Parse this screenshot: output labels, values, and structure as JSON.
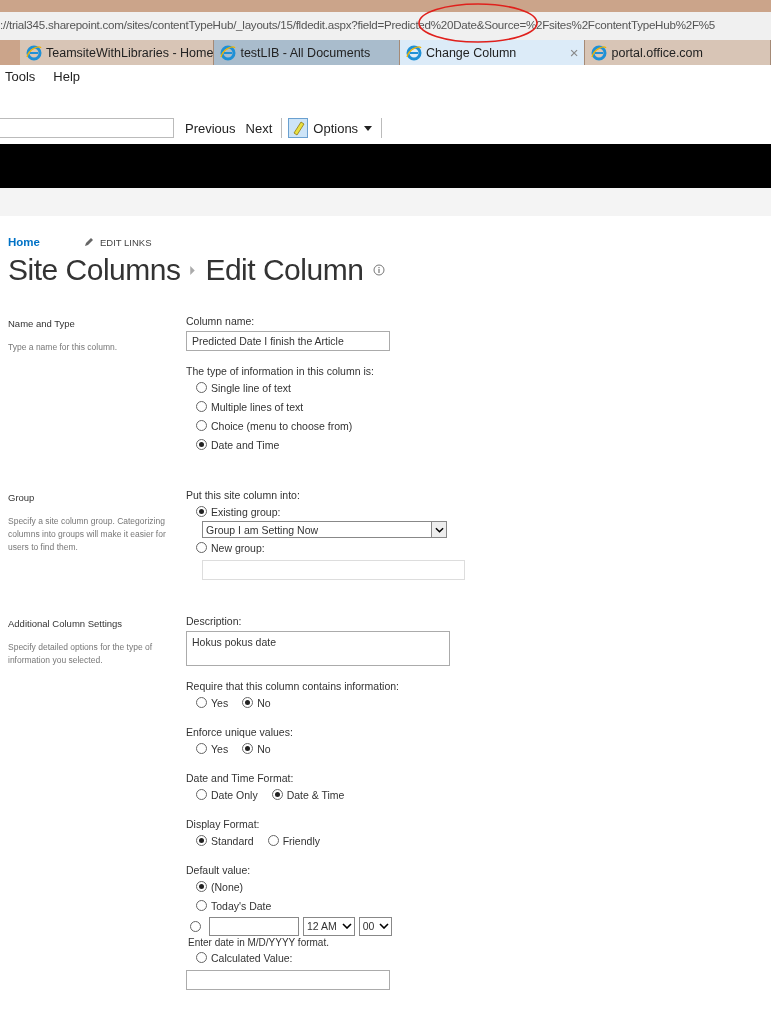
{
  "browser": {
    "address": "://trial345.sharepoint.com/sites/contentTypeHub/_layouts/15/fldedit.aspx?field=Predicted%20Date&Source=%2Fsites%2FcontentTypeHub%2F%5",
    "tabs": [
      {
        "label": "TeamsiteWithLibraries - Home",
        "selected": false
      },
      {
        "label": "testLIB - All Documents",
        "selected": false
      },
      {
        "label": "Change Column",
        "selected": true
      },
      {
        "label": "portal.office.com",
        "selected": false
      }
    ],
    "close_glyph": "×",
    "menu": [
      "Tools",
      "Help"
    ],
    "toolbar": {
      "buttons": [
        "Previous",
        "Next"
      ],
      "options": "Options"
    }
  },
  "page": {
    "home_link": "Home",
    "edit_links": "EDIT LINKS",
    "title": [
      "Site Columns",
      "Edit Column"
    ],
    "sections": [
      {
        "title": "Name and Type",
        "description": "Type a name for this column.",
        "items": [
          {
            "kind": "label",
            "text": "Column name:"
          },
          {
            "kind": "input",
            "value": "Predicted Date I finish the Article"
          },
          {
            "kind": "label",
            "text": "The type of information in this column is:"
          },
          {
            "kind": "radio",
            "label": "Single line of text",
            "selected": false
          },
          {
            "kind": "radio",
            "label": "Multiple lines of text",
            "selected": false
          },
          {
            "kind": "radio",
            "label": "Choice (menu to choose from)",
            "selected": false
          },
          {
            "kind": "radio",
            "label": "Date and Time",
            "selected": true
          }
        ]
      },
      {
        "title": "Group",
        "description": "Specify a site column group. Categorizing columns into groups will make it easier for users to find them.",
        "items": [
          {
            "kind": "label",
            "text": "Put this site column into:"
          },
          {
            "kind": "radio",
            "label": "Existing group:",
            "selected": true
          },
          {
            "kind": "select",
            "value": "Group I am Setting Now"
          },
          {
            "kind": "radio",
            "label": "New group:",
            "selected": false
          },
          {
            "kind": "input_indented"
          }
        ]
      },
      {
        "title": "Additional Column Settings",
        "description": "Specify detailed options for the type of information you selected.",
        "items": [
          {
            "kind": "label",
            "text": "Description:"
          },
          {
            "kind": "textarea",
            "value": "Hokus pokus date"
          },
          {
            "kind": "label",
            "text": "Require that this column contains information:"
          },
          {
            "kind": "radio_row",
            "options": [
              {
                "label": "Yes",
                "selected": false
              },
              {
                "label": "No",
                "selected": true
              }
            ]
          },
          {
            "kind": "label",
            "text": "Enforce unique values:"
          },
          {
            "kind": "radio_row",
            "options": [
              {
                "label": "Yes",
                "selected": false
              },
              {
                "label": "No",
                "selected": true
              }
            ]
          },
          {
            "kind": "label",
            "text": "Date and Time Format:"
          },
          {
            "kind": "radio_row",
            "options": [
              {
                "label": "Date Only",
                "selected": false
              },
              {
                "label": "Date & Time",
                "selected": true
              }
            ]
          },
          {
            "kind": "label",
            "text": "Display Format:"
          },
          {
            "kind": "radio_row",
            "options": [
              {
                "label": "Standard",
                "selected": true
              },
              {
                "label": "Friendly",
                "selected": false
              }
            ]
          },
          {
            "kind": "label",
            "text": "Default value:"
          },
          {
            "kind": "radio",
            "label": "(None)",
            "selected": true
          },
          {
            "kind": "radio",
            "label": "Today's Date",
            "selected": false
          },
          {
            "kind": "date_radio",
            "selected": false,
            "hour": "12 AM",
            "minute": "00"
          },
          {
            "kind": "note",
            "text": "Enter date in M/D/YYYY format."
          },
          {
            "kind": "radio",
            "label": "Calculated Value:",
            "selected": false
          },
          {
            "kind": "input"
          }
        ]
      }
    ]
  }
}
